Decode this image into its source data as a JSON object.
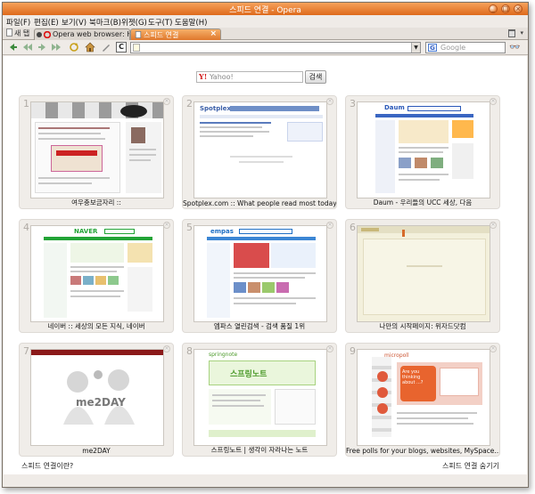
{
  "window": {
    "title": "스피드 연결 - Opera",
    "controls": [
      "_",
      "□",
      "×"
    ]
  },
  "menubar": {
    "items": [
      "파일(F)",
      "편집(E)",
      "보기(V)",
      "북마크(B)",
      "위젯(G)",
      "도구(T)",
      "도움말(H)"
    ]
  },
  "tabbar": {
    "new_tab_label": "새 탭",
    "tabs": [
      {
        "label": "Opera web browser: H...",
        "active": false
      },
      {
        "label": "스피드 연결",
        "active": true
      }
    ],
    "close_glyph": "×"
  },
  "toolbar": {
    "address_value": "",
    "search_placeholder": "Google",
    "search_engine_glyph": "G"
  },
  "search": {
    "placeholder": "Yahoo!",
    "logo_glyph": "Y!",
    "button_label": "검색"
  },
  "speed_dial": {
    "tiles": [
      {
        "number": "1",
        "caption": "여우충보금자리 ::"
      },
      {
        "number": "2",
        "caption": "Spotplex.com :: What people read most today"
      },
      {
        "number": "3",
        "caption": "Daum - 우리들의 UCC 세상, 다음"
      },
      {
        "number": "4",
        "caption": "네이버 :: 세상의 모든 지식, 네이버"
      },
      {
        "number": "5",
        "caption": "엠파스 열린검색 - 검색 품질 1위"
      },
      {
        "number": "6",
        "caption": "나만의 시작페이지: 위자드닷컴"
      },
      {
        "number": "7",
        "caption": "me2DAY"
      },
      {
        "number": "8",
        "caption": "스프링노트 | 생각이 자라나는 노트"
      },
      {
        "number": "9",
        "caption": "Free polls for your blogs, websites, MySpace..."
      }
    ],
    "thumb_text": {
      "spotplex_logo": "Spotplex",
      "daum_logo": "Daum",
      "naver_logo": "NAVER",
      "empas_logo": "empas",
      "me2day_logo": "me2DAY",
      "springnote_logo": "스프링노트",
      "springnote_brand": "springnote",
      "poll_brand": "micropoll",
      "poll_question": "Are you thinking about ...?"
    }
  },
  "footer": {
    "left_link": "스피드 연결이란?",
    "right_link": "스피드 연결 숨기기"
  },
  "colors": {
    "title_bar": "#e47f37",
    "active_tab": "#e0782c",
    "tile_bg": "#f0ede9"
  }
}
